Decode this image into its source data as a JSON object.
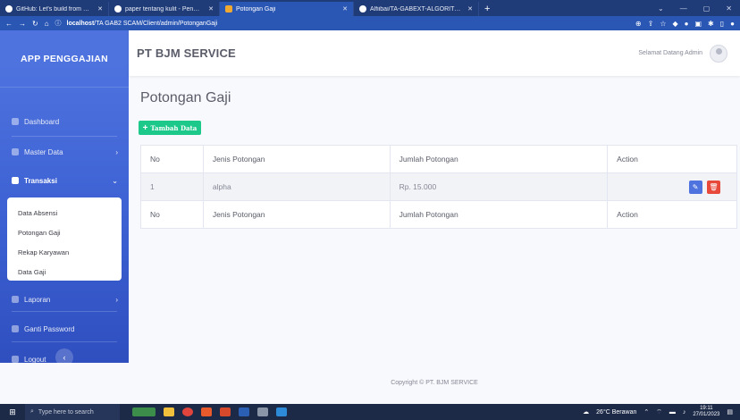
{
  "browser": {
    "tabs": [
      {
        "title": "GitHub: Let's build from here · Gi"
      },
      {
        "title": "paper tentang kulit - Penelusuran"
      },
      {
        "title": "Potongan Gaji"
      },
      {
        "title": "Alfiibai/TA-GABEXT-ALGORITEAM"
      }
    ],
    "url_host": "localhost",
    "url_path": "/TA GAB2 SCAM/Client/admin/PotonganGaji"
  },
  "sidebar": {
    "brand": "APP PENGGAJIAN",
    "items": [
      {
        "label": "Dashboard"
      },
      {
        "label": "Master Data"
      },
      {
        "label": "Transaksi"
      },
      {
        "label": "Laporan"
      },
      {
        "label": "Ganti Password"
      },
      {
        "label": "Logout"
      }
    ],
    "submenu": [
      {
        "label": "Data Absensi"
      },
      {
        "label": "Potongan Gaji"
      },
      {
        "label": "Rekap Karyawan"
      },
      {
        "label": "Data Gaji"
      }
    ]
  },
  "topbar": {
    "company": "PT BJM SERVICE",
    "welcome": "Selamat Datang Admin"
  },
  "main": {
    "title": "Potongan Gaji",
    "add_button": "Tambah Data",
    "table": {
      "headers": [
        "No",
        "Jenis Potongan",
        "Jumlah Potongan",
        "Action"
      ],
      "rows": [
        {
          "no": "1",
          "jenis": "alpha",
          "jumlah": "Rp. 15.000"
        }
      ],
      "footer": [
        "No",
        "Jenis Potongan",
        "Jumlah Potongan",
        "Action"
      ]
    }
  },
  "footer": {
    "text": "Copyright © PT. BJM SERVICE"
  },
  "taskbar": {
    "search_placeholder": "Type here to search",
    "weather": "26°C Berawan",
    "time": "19:11",
    "date": "27/01/2023"
  }
}
